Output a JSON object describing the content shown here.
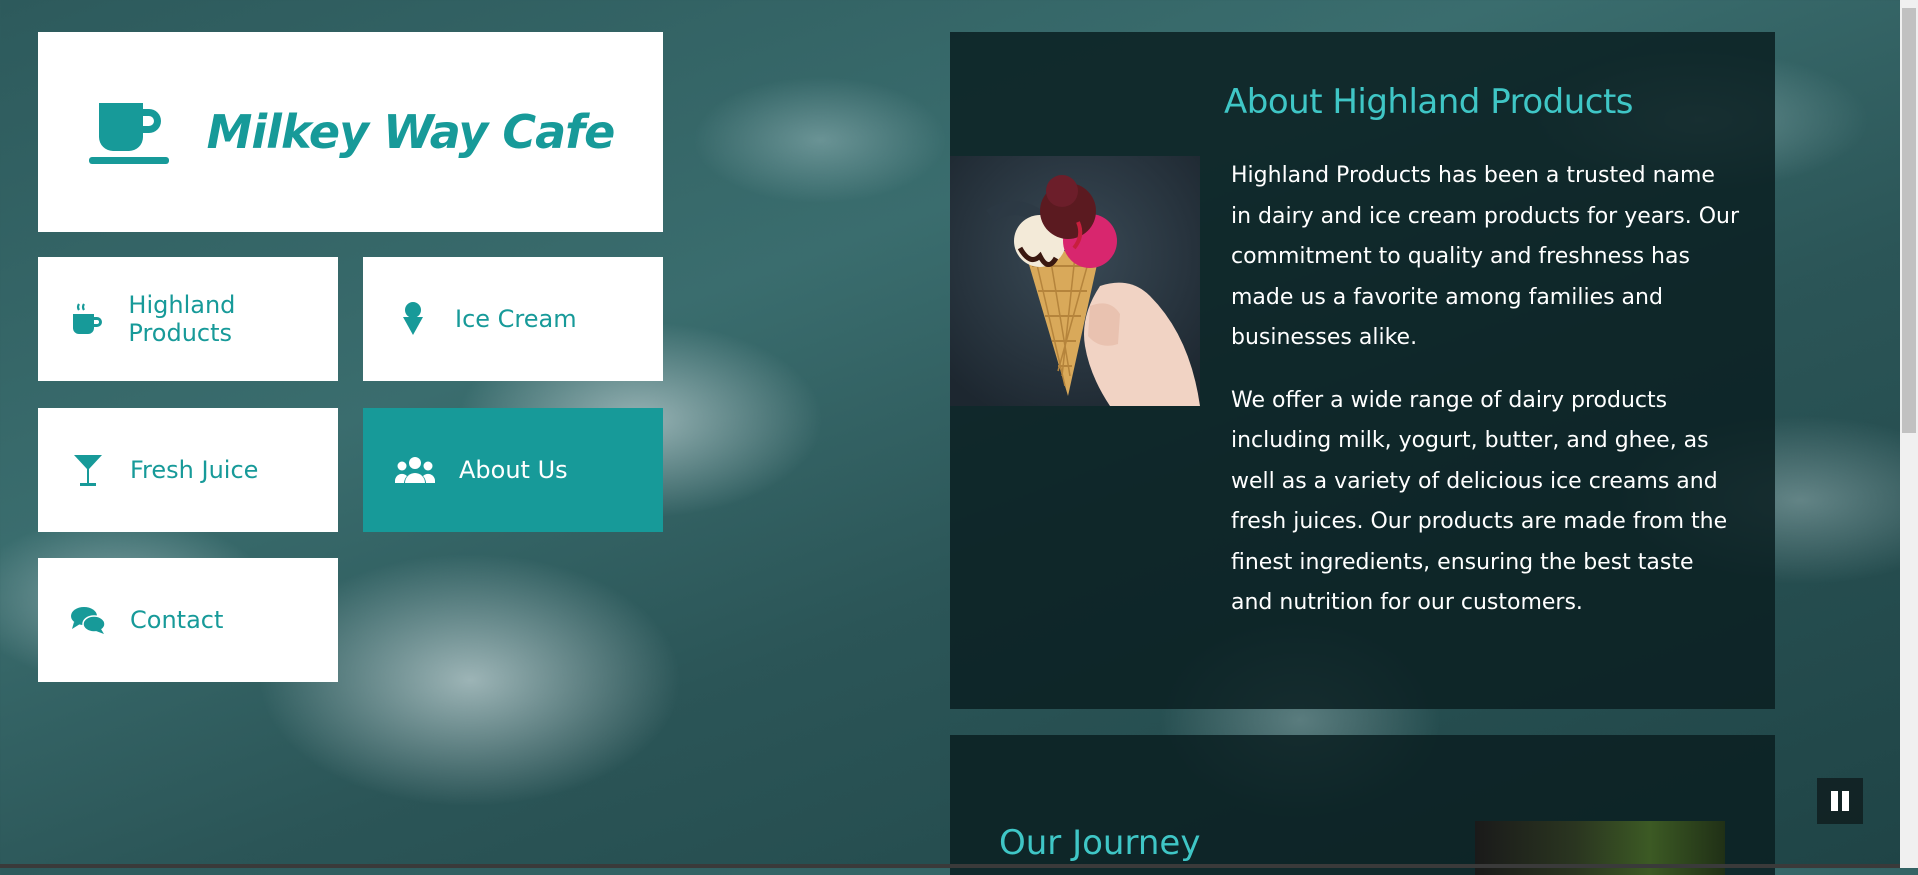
{
  "brand": {
    "title": "Milkey Way Cafe",
    "icon": "coffee-cup-icon"
  },
  "nav": {
    "items": [
      {
        "label": "Highland Products",
        "icon": "mug-hot-icon",
        "active": false
      },
      {
        "label": "Ice Cream",
        "icon": "ice-cream-icon",
        "active": false
      },
      {
        "label": "Fresh Juice",
        "icon": "cocktail-glass-icon",
        "active": false
      },
      {
        "label": "About Us",
        "icon": "users-icon",
        "active": true
      },
      {
        "label": "Contact",
        "icon": "comments-icon",
        "active": false
      }
    ]
  },
  "about": {
    "title": "About Highland Products",
    "paragraph1": "Highland Products has been a trusted name in dairy and ice cream products for years. Our commitment to quality and freshness has made us a favorite among families and businesses alike.",
    "paragraph2": "We offer a wide range of dairy products including milk, yogurt, butter, and ghee, as well as a variety of delicious ice creams and fresh juices. Our products are made from the finest ingredients, ensuring the best taste and nutrition for our customers."
  },
  "journey": {
    "title": "Our Journey"
  },
  "colors": {
    "accent": "#179a99",
    "heading": "#3fc6c6",
    "panel": "#0b2022"
  }
}
